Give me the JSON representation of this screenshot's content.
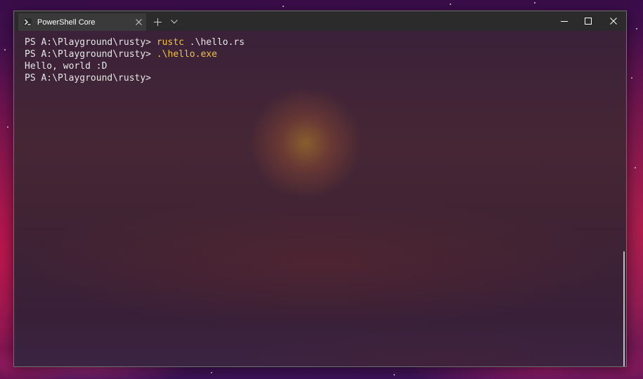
{
  "tab": {
    "title": "PowerShell Core",
    "icon": "powershell-icon"
  },
  "window_controls": {
    "new_tab_icon": "plus-icon",
    "dropdown_icon": "chevron-down-icon",
    "minimize_icon": "minimize-icon",
    "maximize_icon": "maximize-icon",
    "close_icon": "close-icon"
  },
  "terminal": {
    "lines": [
      {
        "prompt": "PS A:\\Playground\\rusty> ",
        "command": "rustc",
        "args": " .\\hello.rs"
      },
      {
        "prompt": "PS A:\\Playground\\rusty> ",
        "command": ".\\hello.exe",
        "args": ""
      },
      {
        "output": "Hello, world :D"
      },
      {
        "prompt": "PS A:\\Playground\\rusty>",
        "command": "",
        "args": ""
      }
    ]
  },
  "colors": {
    "command": "#f0c14a",
    "text": "#e6e6e6",
    "titlebar": "#2b2b2b",
    "tab_active": "#3a3a3a"
  }
}
